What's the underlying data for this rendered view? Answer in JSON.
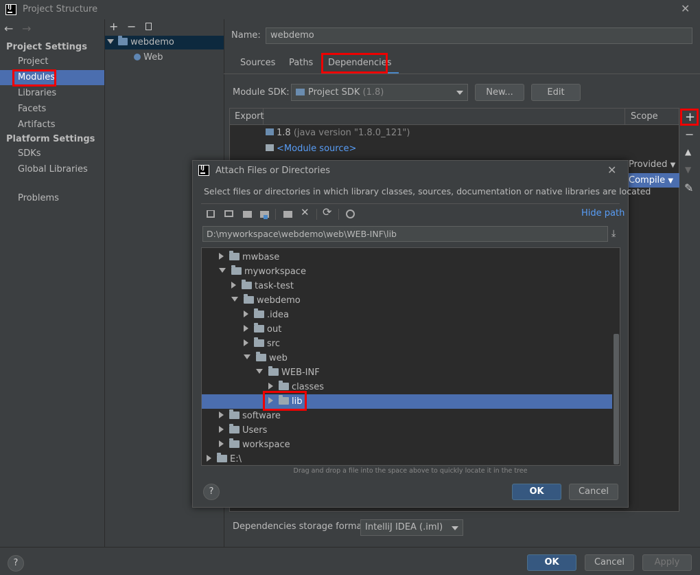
{
  "window": {
    "title": "Project Structure"
  },
  "nav": {
    "back_glyph": "←",
    "forward_glyph": "→",
    "project_settings": "Project Settings",
    "items_ps": [
      "Project",
      "Modules",
      "Libraries",
      "Facets",
      "Artifacts"
    ],
    "platform_settings": "Platform Settings",
    "items_plat": [
      "SDKs",
      "Global Libraries"
    ],
    "problems": "Problems",
    "selected": "Modules"
  },
  "module_tree": {
    "toolbar": [
      "+",
      "−",
      "copy-icon"
    ],
    "root": "webdemo",
    "child": "Web"
  },
  "module": {
    "name_label": "Name:",
    "name_value": "webdemo",
    "tabs": [
      "Sources",
      "Paths",
      "Dependencies"
    ],
    "active_tab": "Dependencies",
    "sdk_label": "Module SDK:",
    "sdk_value": "Project SDK",
    "sdk_version": "(1.8)",
    "new_button": "New...",
    "edit_button": "Edit",
    "table_headers": {
      "export": "Export",
      "scope": "Scope"
    },
    "rows": [
      {
        "name": "1.8",
        "detail": "(java version \"1.8.0_121\")"
      },
      {
        "name": "<Module source>"
      }
    ],
    "scope_provided": "Provided",
    "scope_compile": "Compile",
    "side_toolbar": [
      "+",
      "−",
      "▲",
      "▼",
      "✎"
    ],
    "storage_label": "Dependencies storage format:",
    "storage_value": "IntelliJ IDEA (.iml)"
  },
  "dialog": {
    "title": "Attach Files or Directories",
    "description": "Select files or directories in which library classes, sources, documentation or native libraries are located",
    "hide_path": "Hide path",
    "path_value": "D:\\myworkspace\\webdemo\\web\\WEB-INF\\lib",
    "tree": [
      {
        "label": "mwbase",
        "level": 1,
        "state": "collapsed"
      },
      {
        "label": "myworkspace",
        "level": 1,
        "state": "expanded"
      },
      {
        "label": "task-test",
        "level": 2,
        "state": "collapsed"
      },
      {
        "label": "webdemo",
        "level": 2,
        "state": "expanded"
      },
      {
        "label": ".idea",
        "level": 3,
        "state": "collapsed"
      },
      {
        "label": "out",
        "level": 3,
        "state": "collapsed"
      },
      {
        "label": "src",
        "level": 3,
        "state": "collapsed"
      },
      {
        "label": "web",
        "level": 3,
        "state": "expanded"
      },
      {
        "label": "WEB-INF",
        "level": 4,
        "state": "expanded"
      },
      {
        "label": "classes",
        "level": 5,
        "state": "collapsed"
      },
      {
        "label": "lib",
        "level": 5,
        "state": "collapsed",
        "selected": true
      },
      {
        "label": "software",
        "level": 1,
        "state": "collapsed"
      },
      {
        "label": "Users",
        "level": 1,
        "state": "collapsed"
      },
      {
        "label": "workspace",
        "level": 1,
        "state": "collapsed"
      },
      {
        "label": "E:\\",
        "level": 0,
        "state": "collapsed"
      }
    ],
    "hint": "Drag and drop a file into the space above to quickly locate it in the tree",
    "help": "?",
    "ok": "OK",
    "cancel": "Cancel"
  },
  "footer": {
    "help": "?",
    "ok": "OK",
    "cancel": "Cancel",
    "apply": "Apply"
  },
  "colors": {
    "selection": "#4b6eaf",
    "highlight": "#ee0000",
    "primary_button": "#365880"
  }
}
